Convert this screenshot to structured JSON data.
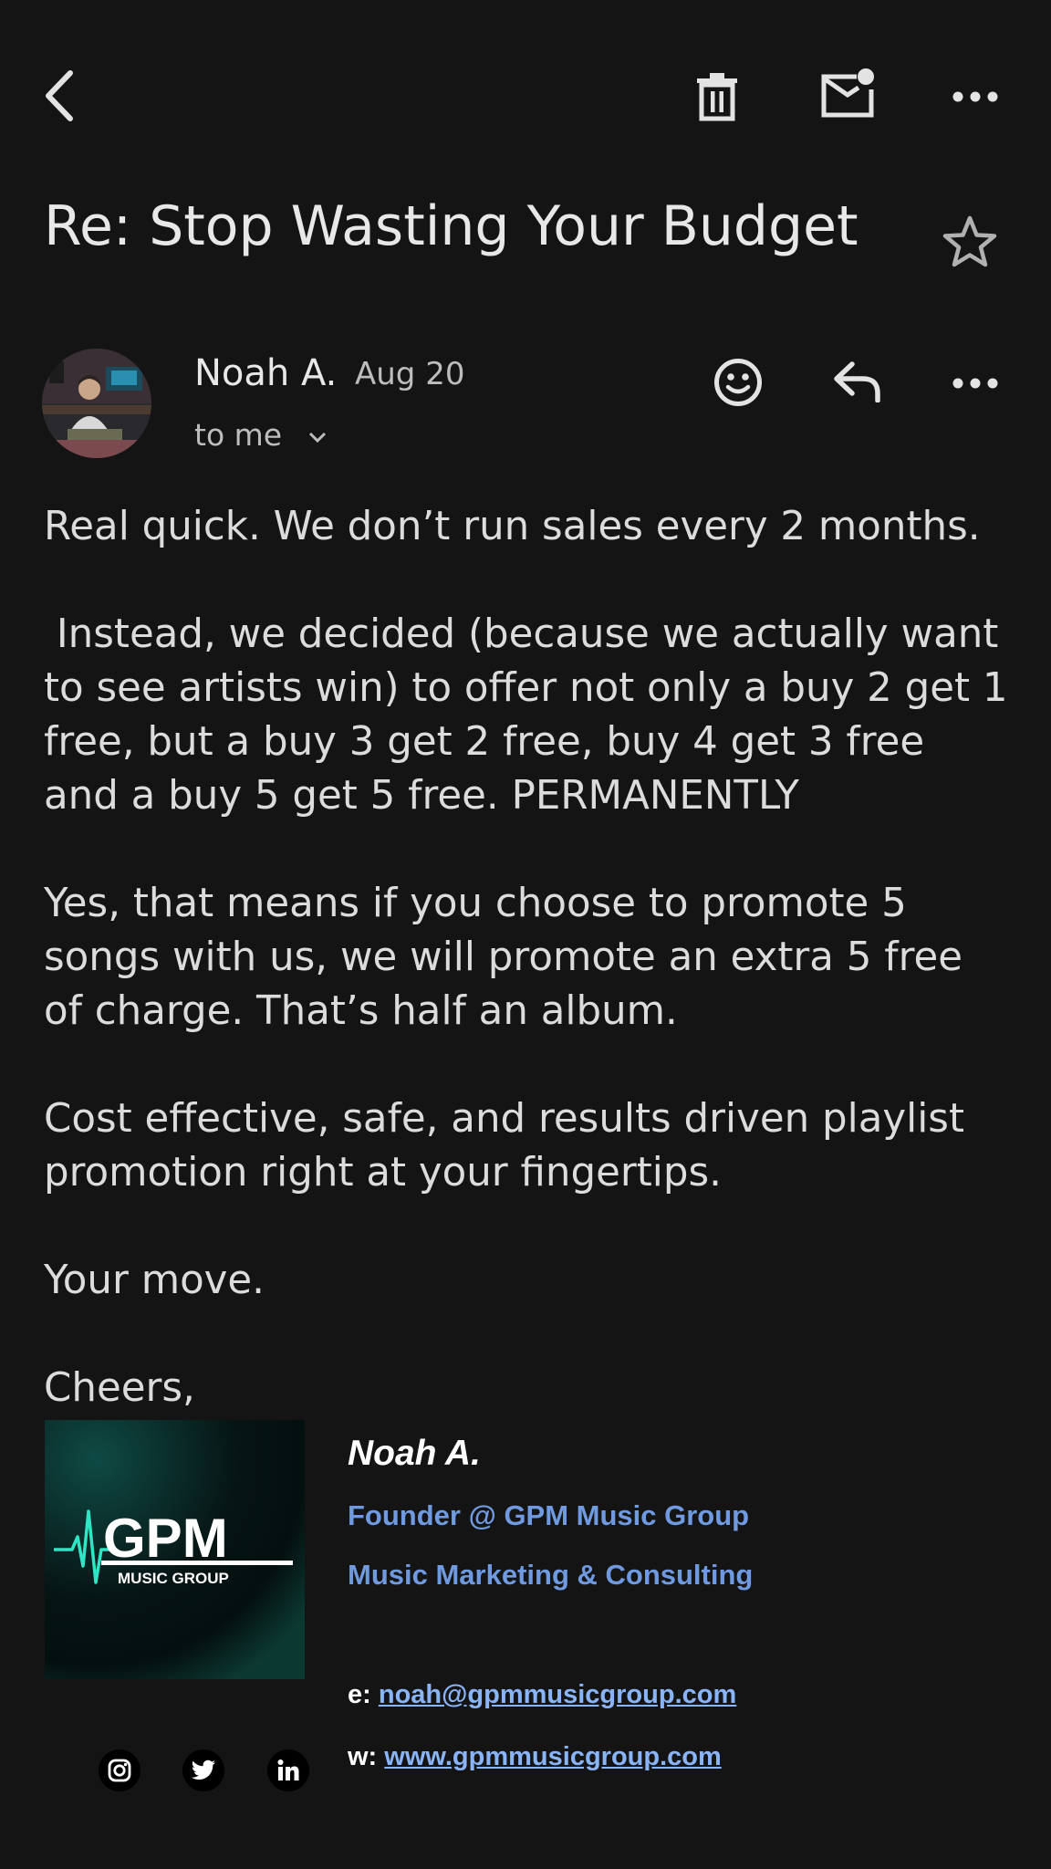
{
  "toolbar": {
    "back_icon": "back-arrow-icon",
    "delete_icon": "trash-icon",
    "mark_unread_icon": "mail-unread-icon",
    "more_icon": "more-horizontal-icon"
  },
  "email": {
    "subject": "Re: Stop Wasting Your Budget",
    "starred": false
  },
  "sender": {
    "name": "Noah A.",
    "date": "Aug 20",
    "recipient_label": "to me"
  },
  "body": {
    "paragraphs": [
      [
        "Real quick. We don’t run sales every 2 months."
      ],
      [
        " Instead, we decided (because we actually want",
        "to see artists win) to offer not only a buy 2 get 1",
        "free, but a buy 3 get 2 free, buy 4 get 3 free",
        "and a buy 5 get 5 free. PERMANENTLY"
      ],
      [
        "Yes, that means if you choose to promote 5",
        "songs with us, we will promote an extra 5 free",
        "of charge. That’s half an album."
      ],
      [
        "Cost effective, safe, and results driven playlist",
        "promotion right at your fingertips."
      ],
      [
        "Your move."
      ],
      [
        "Cheers,"
      ]
    ]
  },
  "signature": {
    "logo_text": "GPM",
    "logo_subtext": "MUSIC GROUP",
    "name": "Noah A.",
    "title": "Founder @ GPM Music Group",
    "tagline": "Music Marketing & Consulting",
    "email_label": "e:",
    "email": "noah@gpmmusicgroup.com",
    "website_label": "w:",
    "website": "www.gpmmusicgroup.com",
    "social_icons": [
      "instagram-icon",
      "twitter-icon",
      "linkedin-icon"
    ]
  },
  "colors": {
    "background": "#141414",
    "text": "#dcdcdc",
    "link": "#8ab4f8",
    "signature_accent": "#6f9ae0",
    "logo_teal": "#2ee6c6"
  }
}
